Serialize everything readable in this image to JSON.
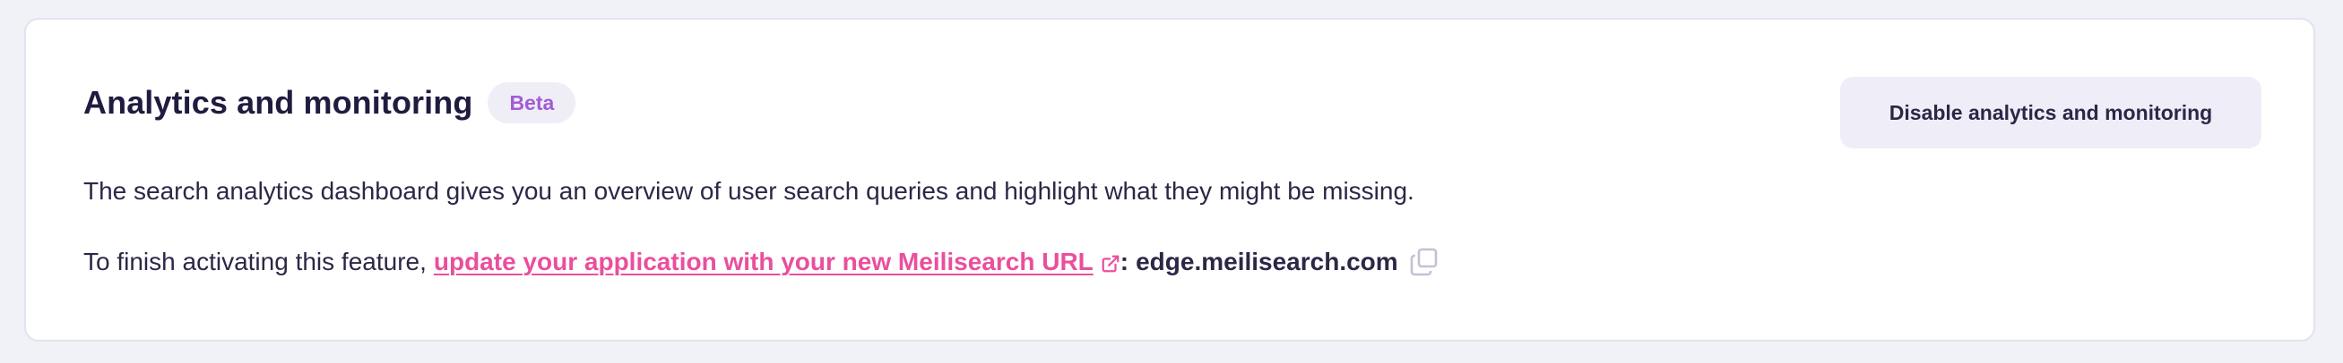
{
  "card": {
    "title": "Analytics and monitoring",
    "badge": "Beta",
    "disable_button_label": "Disable analytics and monitoring",
    "description": "The search analytics dashboard gives you an overview of user search queries and highlight what they might be missing.",
    "activation": {
      "prefix": "To finish activating this feature,",
      "link_text": "update your application with your new Meilisearch URL",
      "separator": ":",
      "url": "edge.meilisearch.com"
    }
  },
  "icons": {
    "external_link": "external-link-icon",
    "copy": "copy-icon"
  },
  "colors": {
    "background": "#f1f1f8",
    "card": "#ffffff",
    "title": "#1f1c3f",
    "badge_bg": "#efeef7",
    "badge_text": "#a25bd6",
    "link": "#ea4f9c",
    "button_bg": "#efeef8",
    "text": "#2b2847"
  }
}
